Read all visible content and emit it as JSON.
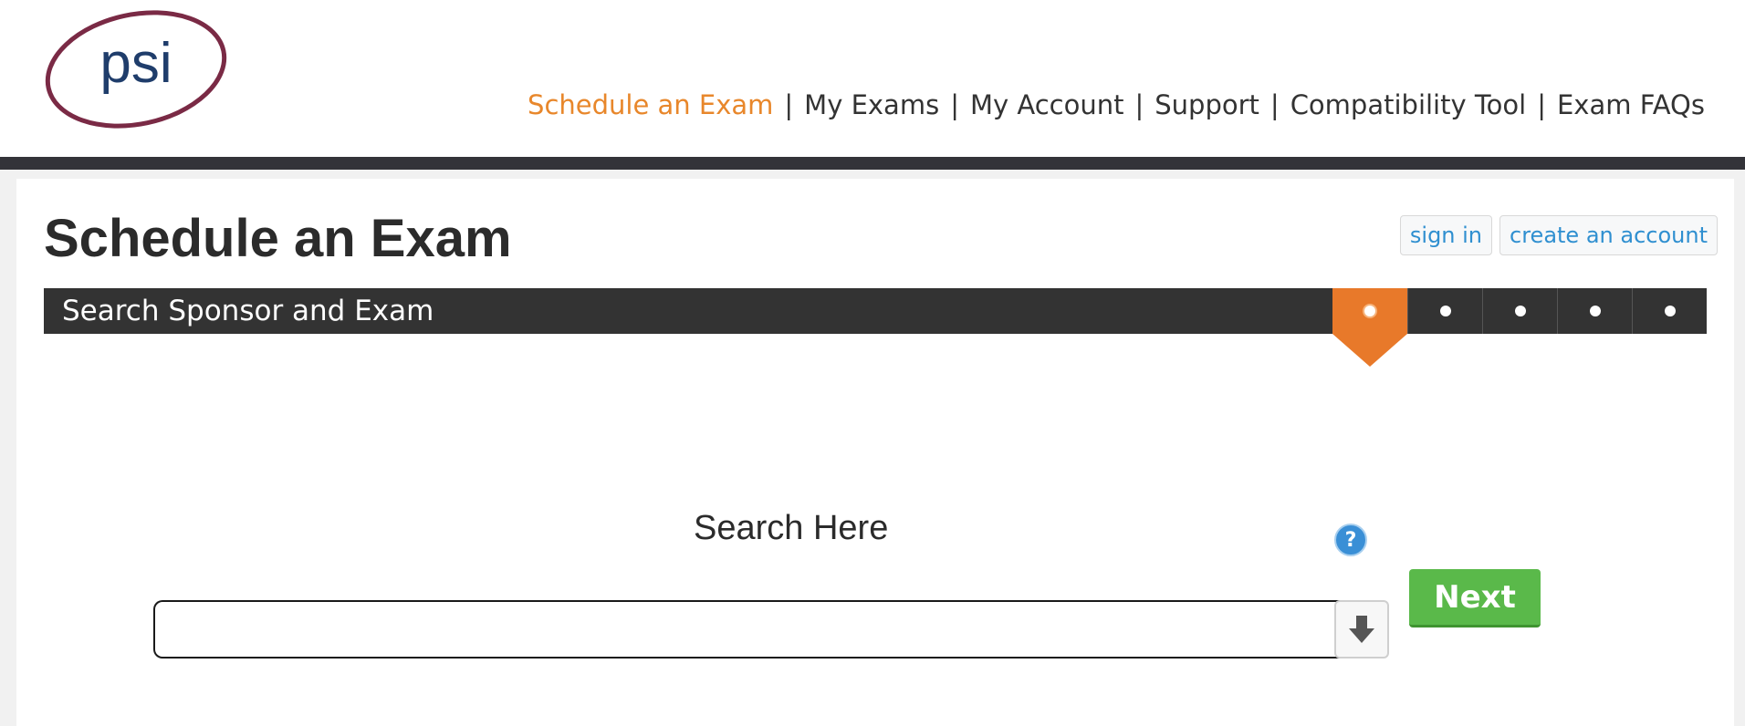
{
  "brand": {
    "logo_text": "psi",
    "ring_color": "#7a2a45",
    "text_color": "#1f3d6b"
  },
  "nav": {
    "items": [
      {
        "label": "Schedule an Exam",
        "active": true
      },
      {
        "label": "My Exams"
      },
      {
        "label": "My Account"
      },
      {
        "label": "Support"
      },
      {
        "label": "Compatibility Tool"
      },
      {
        "label": "Exam FAQs"
      }
    ],
    "separator": "|",
    "active_color": "#e8872b"
  },
  "page": {
    "title": "Schedule an Exam"
  },
  "auth": {
    "sign_in_label": "sign in",
    "create_account_label": "create an account"
  },
  "stepper": {
    "label": "Search Sponsor and Exam",
    "total_steps": 5,
    "current_step": 1,
    "active_color": "#e8792a"
  },
  "search": {
    "label": "Search Here",
    "value": "",
    "placeholder": "",
    "help_symbol": "?"
  },
  "actions": {
    "next_label": "Next",
    "next_color": "#5ab94a"
  }
}
